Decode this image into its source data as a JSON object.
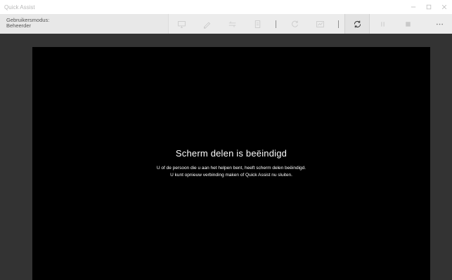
{
  "window": {
    "title": "Quick Assist",
    "controls": [
      "minimize-icon",
      "maximize-icon",
      "close-icon"
    ]
  },
  "toolbar": {
    "mode_label": "Gebruikersmodus:",
    "mode_value": "Beheerder",
    "buttons": [
      {
        "icon": "monitor-select-icon",
        "enabled": false
      },
      {
        "icon": "annotate-icon",
        "enabled": false
      },
      {
        "icon": "actual-size-icon",
        "enabled": false
      },
      {
        "icon": "instruction-channel-icon",
        "enabled": false
      },
      {
        "icon": "restart-icon",
        "enabled": false
      },
      {
        "icon": "task-manager-icon",
        "enabled": false
      },
      {
        "icon": "reconnect-icon",
        "enabled": true
      },
      {
        "icon": "pause-icon",
        "enabled": false
      },
      {
        "icon": "stop-icon",
        "enabled": false
      },
      {
        "icon": "more-icon",
        "enabled": true
      }
    ]
  },
  "session": {
    "title": "Scherm delen is beëindigd",
    "line1": "U of de persoon die u aan het helpen bent, heeft scherm delen beëindigd.",
    "line2": "U kunt opnieuw verbinding maken of Quick Assist nu sluiten."
  },
  "colors": {
    "background": "#333333",
    "screen": "#000000",
    "toolbar": "#ececec"
  }
}
